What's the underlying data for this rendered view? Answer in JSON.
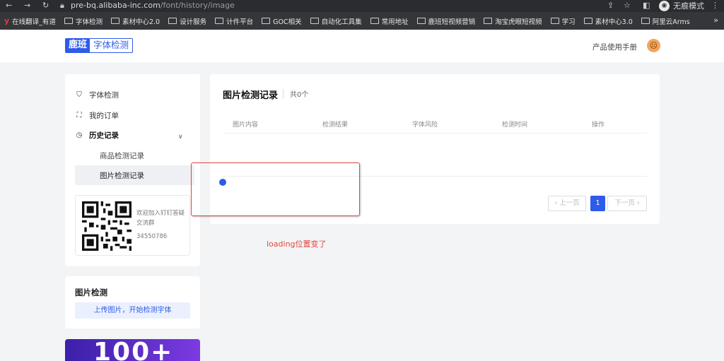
{
  "browser": {
    "url_host": "pre-bq.alibaba-inc.com",
    "url_path": "/font/history/image",
    "incognito_label": "无痕模式"
  },
  "bookmarks": [
    {
      "label": "在线翻译_有道",
      "icon": "youdao-icon"
    },
    {
      "label": "字体检测",
      "icon": "folder-icon"
    },
    {
      "label": "素材中心2.0",
      "icon": "folder-icon"
    },
    {
      "label": "设计服务",
      "icon": "folder-icon"
    },
    {
      "label": "计件平台",
      "icon": "folder-icon"
    },
    {
      "label": "GOC相关",
      "icon": "folder-icon"
    },
    {
      "label": "自动化工具集",
      "icon": "folder-icon"
    },
    {
      "label": "常用地址",
      "icon": "folder-icon"
    },
    {
      "label": "鹿班短视频营销",
      "icon": "folder-icon"
    },
    {
      "label": "淘宝虎眼短视频",
      "icon": "folder-icon"
    },
    {
      "label": "学习",
      "icon": "folder-icon"
    },
    {
      "label": "素材中心3.0",
      "icon": "folder-icon"
    },
    {
      "label": "阿里云Arms",
      "icon": "folder-icon"
    }
  ],
  "header": {
    "logo_brand": "鹿班",
    "logo_product": "字体检测",
    "manual_link": "产品使用手册"
  },
  "sidebar": {
    "items": [
      {
        "label": "字体检测"
      },
      {
        "label": "我的订单"
      },
      {
        "label": "历史记录"
      }
    ],
    "sub_items": [
      {
        "label": "商品检测记录"
      },
      {
        "label": "图片检测记录"
      }
    ],
    "qr": {
      "text": "欢迎加入钉钉答疑交流群",
      "number": "34550786"
    }
  },
  "upload_card": {
    "title": "图片检测",
    "button": "上传图片，开始检测字体"
  },
  "promo": {
    "text": "100+"
  },
  "main": {
    "title": "图片检测记录",
    "count": "共0个",
    "columns": [
      "图片内容",
      "检测结果",
      "字体风险",
      "检测时间",
      "操作"
    ],
    "pagination": {
      "prev": "上一页",
      "current": "1",
      "next": "下一页"
    }
  },
  "annotation": {
    "text": "loading位置变了",
    "color": "#e0473f"
  },
  "colors": {
    "accent": "#2f5bea",
    "page_bg": "#f3f4f6"
  }
}
